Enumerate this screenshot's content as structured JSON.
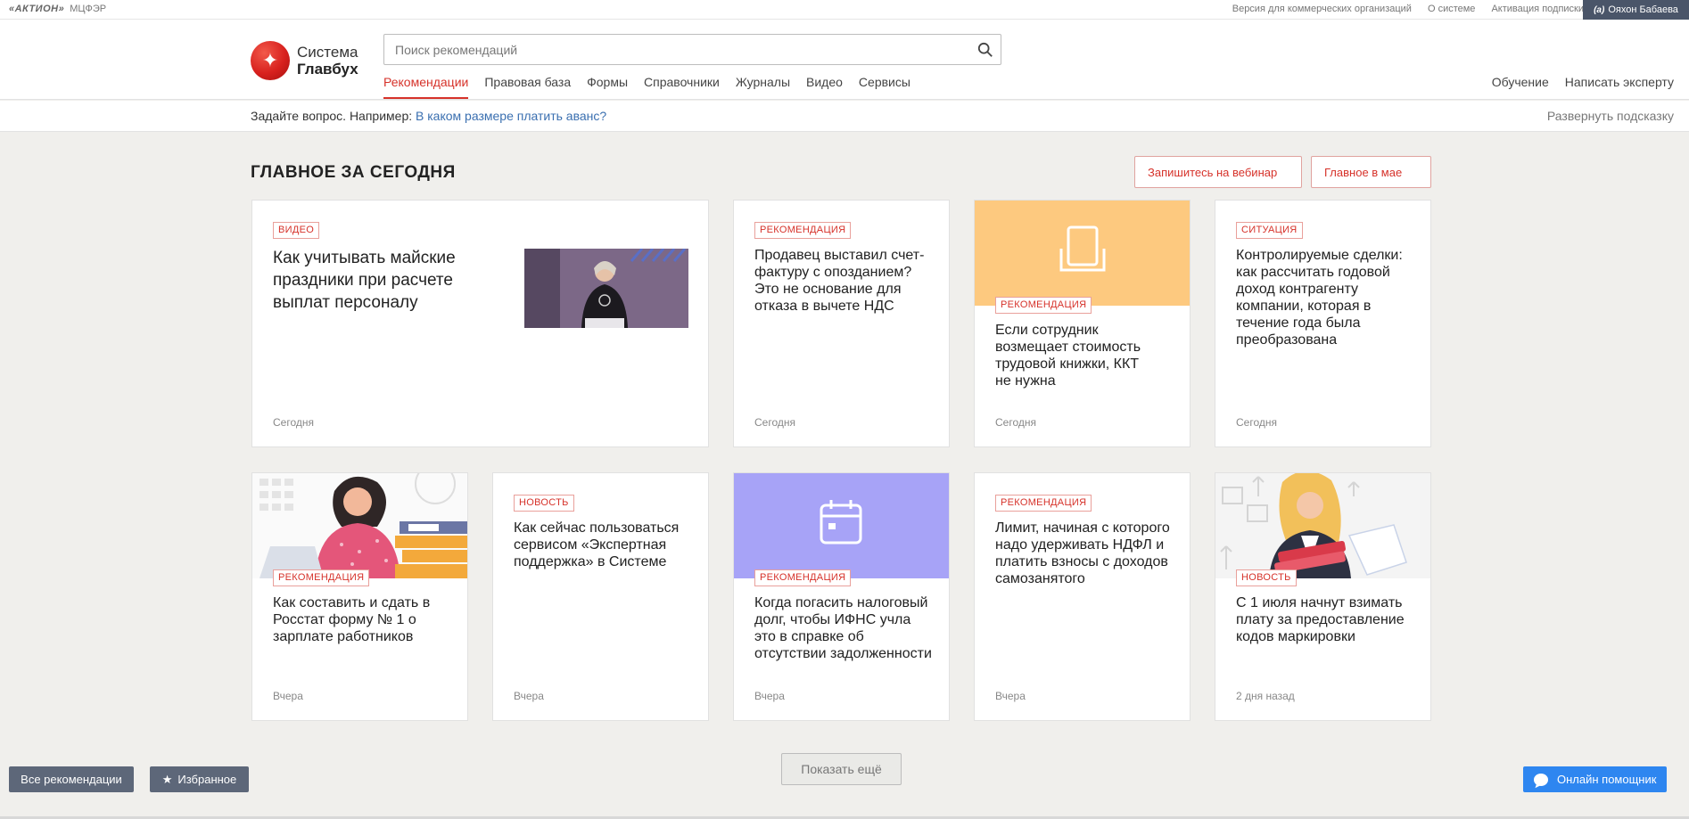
{
  "topbar": {
    "brand_aktion": "«АКТИОН»",
    "brand_mcfer": "МЦФЭР",
    "links": [
      "Версия для коммерческих организаций",
      "О системе",
      "Активация подписки"
    ],
    "user_badge": "(а)",
    "user_name": "Ояхон Бабаева"
  },
  "header": {
    "logo_line1": "Система",
    "logo_line2": "Главбух",
    "search_placeholder": "Поиск рекомендаций",
    "nav": [
      "Рекомендации",
      "Правовая база",
      "Формы",
      "Справочники",
      "Журналы",
      "Видео",
      "Сервисы"
    ],
    "nav_active": "Рекомендации",
    "nav_right": [
      "Обучение",
      "Написать эксперту"
    ]
  },
  "hint": {
    "prefix": "Задайте вопрос. Например: ",
    "example": "В каком размере платить аванс?",
    "expand": "Развернуть подсказку"
  },
  "main": {
    "title": "ГЛАВНОЕ ЗА СЕГОДНЯ",
    "webinar_button": "Запишитесь на вебинар",
    "may_button": "Главное в мае",
    "cards": [
      {
        "badge": "ВИДЕО",
        "title": "Как учитывать майские праздники при расчете выплат персоналу",
        "date": "Сегодня"
      },
      {
        "badge": "РЕКОМЕНДАЦИЯ",
        "title": "Продавец выставил счет-фактуру с опозданием? Это не основание для отказа в вычете НДС",
        "date": "Сегодня"
      },
      {
        "badge": "РЕКОМЕНДАЦИЯ",
        "title": "Если сотрудник возмещает стоимость трудовой книжки, ККТ не нужна",
        "date": "Сегодня"
      },
      {
        "badge": "СИТУАЦИЯ",
        "title": "Контролируемые сделки: как рассчитать годовой доход контрагенту компании, которая в течение года была преобразована",
        "date": "Сегодня"
      },
      {
        "badge": "РЕКОМЕНДАЦИЯ",
        "title": "Как составить и сдать в Росстат форму № 1 о зарплате работников",
        "date": "Вчера"
      },
      {
        "badge": "НОВОСТЬ",
        "title": "Как сейчас пользоваться сервисом «Экспертная поддержка» в Системе",
        "date": "Вчера"
      },
      {
        "badge": "РЕКОМЕНДАЦИЯ",
        "title": "Когда погасить налоговый долг, чтобы ИФНС учла это в справке об отсутствии задолженности",
        "date": "Вчера"
      },
      {
        "badge": "РЕКОМЕНДАЦИЯ",
        "title": "Лимит, начиная с которого надо удерживать НДФЛ и платить взносы с доходов самозанятого",
        "date": "Вчера"
      },
      {
        "badge": "НОВОСТЬ",
        "title": "С 1 июля начнут взимать плату за предоставление кодов маркировки",
        "date": "2 дня назад"
      }
    ],
    "show_more": "Показать ещё"
  },
  "bottom": {
    "all_recs": "Все рекомендации",
    "favorites": "Избранное",
    "helper": "Онлайн помощник"
  },
  "colors": {
    "accent_red": "#d6322a",
    "link_blue": "#3a6fb0",
    "banner_orange": "#fdc97f",
    "banner_purple": "#a7a3f7",
    "button_slate": "#5d6779",
    "helper_blue": "#2e86f0"
  },
  "icons": [
    "search-icon",
    "star-icon",
    "chat-icon",
    "document-icon",
    "calendar-icon"
  ]
}
